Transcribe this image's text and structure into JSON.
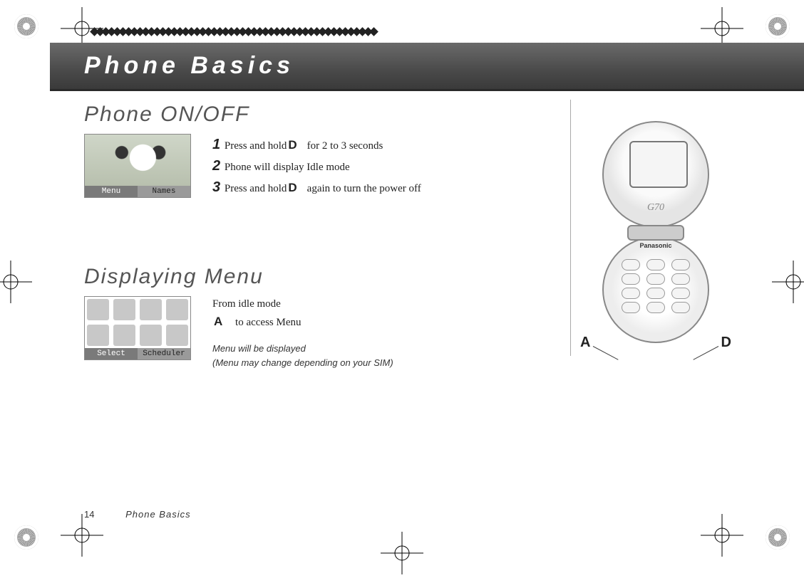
{
  "chapter_title": "Phone Basics",
  "sections": {
    "onoff": {
      "heading": "Phone ON/OFF",
      "steps": [
        {
          "n": "1",
          "pre": "Press and hold",
          "key": "D",
          "post": "for 2 to 3 seconds"
        },
        {
          "n": "2",
          "pre": "Phone will display Idle mode",
          "key": "",
          "post": ""
        },
        {
          "n": "3",
          "pre": "Press and hold",
          "key": "D",
          "post": "again to turn the power off"
        }
      ],
      "softkeys": {
        "left": "Menu",
        "right": "Names"
      }
    },
    "menu": {
      "heading": "Displaying Menu",
      "intro": "From idle mode",
      "action_key": "A",
      "action_text": "to access Menu",
      "note_line1": "Menu will be displayed",
      "note_line2": "(Menu may change depending on your SIM)",
      "softkeys": {
        "left": "Select",
        "right": "Scheduler"
      }
    }
  },
  "phone": {
    "screen_brand": "G70",
    "keypad_brand": "Panasonic",
    "callout_left": "A",
    "callout_right": "D"
  },
  "footer": {
    "page": "14",
    "section": "Phone Basics"
  }
}
